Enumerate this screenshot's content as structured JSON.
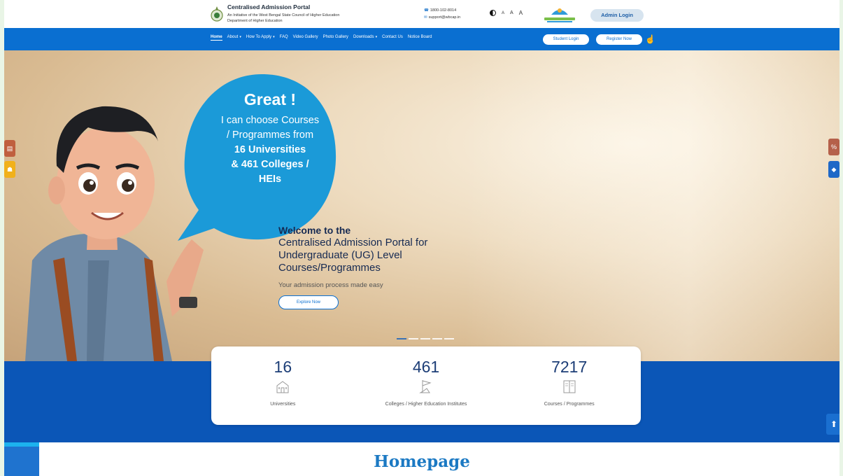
{
  "header": {
    "title": "Centralised Admission Portal",
    "subtitle_line1": "An Initiative of the West Bengal State Council of Higher Education",
    "subtitle_line2": "Department of Higher Education",
    "phone": "1800-102-8014",
    "email": "support@wbcap.in",
    "font_sizes": [
      "A",
      "A",
      "A"
    ],
    "admin_login": "Admin Login"
  },
  "nav": {
    "items": [
      {
        "label": "Home",
        "dropdown": false
      },
      {
        "label": "About",
        "dropdown": true
      },
      {
        "label": "How To Apply",
        "dropdown": true
      },
      {
        "label": "FAQ",
        "dropdown": false
      },
      {
        "label": "Video Gallery",
        "dropdown": false
      },
      {
        "label": "Photo Gallery",
        "dropdown": false
      },
      {
        "label": "Downloads",
        "dropdown": true
      },
      {
        "label": "Contact Us",
        "dropdown": false
      },
      {
        "label": "Notice Board",
        "dropdown": false
      }
    ],
    "student_login": "Student Login",
    "register_now": "Register Now"
  },
  "hero": {
    "bubble_great": "Great !",
    "bubble_line1": "I can choose Courses",
    "bubble_line2": "/ Programmes from",
    "bubble_line3": "16 Universities",
    "bubble_line4": "& 461 Colleges /",
    "bubble_line5": "HEIs",
    "welcome_line1": "Welcome to the",
    "welcome_line2": "Centralised Admission Portal for",
    "welcome_line3": "Undergraduate (UG) Level",
    "welcome_line4": "Courses/Programmes",
    "tagline": "Your admission process made easy",
    "explore": "Explore Now",
    "slide_count": 5,
    "active_slide": 1
  },
  "stats": [
    {
      "number": "16",
      "label": "Universities"
    },
    {
      "number": "461",
      "label": "Colleges / Higher Education Institutes"
    },
    {
      "number": "7217",
      "label": "Courses / Programmes"
    }
  ],
  "page_title": "Homepage",
  "colors": {
    "primary_blue": "#0a6fd1",
    "band_blue": "#0b56b7",
    "bubble_blue": "#1b9ad8",
    "title_blue": "#1b79c3"
  }
}
